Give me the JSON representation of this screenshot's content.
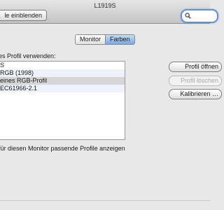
{
  "window": {
    "title": "L1919S",
    "show_all_label": "le einblenden",
    "search_placeholder": ""
  },
  "tabs": [
    {
      "label": "Monitor",
      "selected": false
    },
    {
      "label": "Farben",
      "selected": true
    }
  ],
  "profiles": {
    "section_label": "es Profil verwenden:",
    "items": [
      {
        "label": "S"
      },
      {
        "label": "RGB (1998)"
      },
      {
        "label": "eines RGB-Profil",
        "selected": true
      },
      {
        "label": "EC61966-2.1"
      }
    ]
  },
  "buttons": {
    "open": "Profil öffnen",
    "delete": "Profil löschen",
    "calibrate": "Kalibrieren …"
  },
  "filter_label": "für diesen Monitor passende Profile anzeigen"
}
